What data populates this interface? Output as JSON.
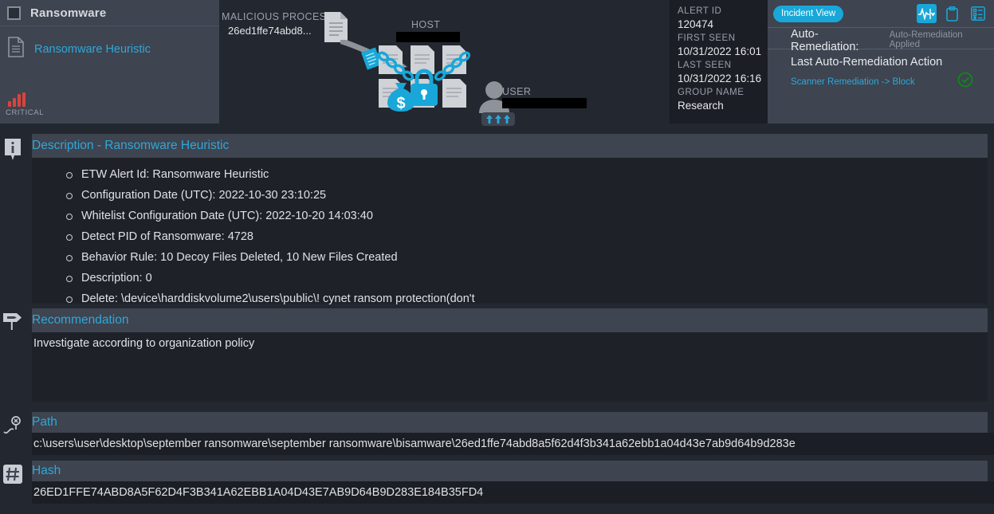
{
  "alert_card": {
    "title": "Ransomware",
    "rule_name": "Ransomware Heuristic",
    "severity_label": "CRITICAL",
    "severity_color": "#d6453e",
    "checkbox_checked": false
  },
  "diagram": {
    "malicious_process_label": "MALICIOUS PROCESS",
    "malicious_process_value": "26ed1ffe74abd8...",
    "host_label": "HOST",
    "host_value": "",
    "user_label": "USER",
    "user_value": "",
    "host_redacted": true,
    "user_redacted": true,
    "accent_color": "#18a7d8"
  },
  "alert_meta": {
    "alert_id_label": "ALERT ID",
    "alert_id": "120474",
    "first_seen_label": "FIRST SEEN",
    "first_seen": "10/31/2022 16:01",
    "last_seen_label": "LAST SEEN",
    "last_seen": "10/31/2022 16:16",
    "group_name_label": "GROUP NAME",
    "group_name": "Research"
  },
  "right_panel": {
    "incident_view_button": "Incident View",
    "auto_remediation_label": "Auto-Remediation:",
    "auto_remediation_value": "Auto-Remediation Applied",
    "last_action_title": "Last Auto-Remediation Action",
    "last_action_value": "Scanner Remediation -> Block",
    "status_ok_color": "#0f8a18"
  },
  "description": {
    "heading": "Description - Ransomware Heuristic",
    "items": [
      "ETW Alert Id: Ransomware Heuristic",
      "Configuration Date (UTC): 2022-10-30 23:10:25",
      "Whitelist Configuration Date (UTC): 2022-10-20 14:03:40",
      "Detect PID of Ransomware: 4728",
      "Behavior Rule: 10 Decoy Files Deleted, 10 New Files Created",
      "Description: 0",
      "Delete: \\device\\harddiskvolume2\\users\\public\\! cynet ransom protection(don't"
    ]
  },
  "recommendation": {
    "heading": "Recommendation",
    "text": "Investigate according to organization policy"
  },
  "path": {
    "heading": "Path",
    "value": "c:\\users\\user\\desktop\\september ransomware\\september ransomware\\bisamware\\26ed1ffe74abd8a5f62d4f3b341a62ebb1a04d43e7ab9d64b9d283e"
  },
  "hash": {
    "heading": "Hash",
    "value": "26ED1FFE74ABD8A5F62D4F3B341A62EBB1A04D43E7AB9D64B9D283E184B35FD4"
  }
}
